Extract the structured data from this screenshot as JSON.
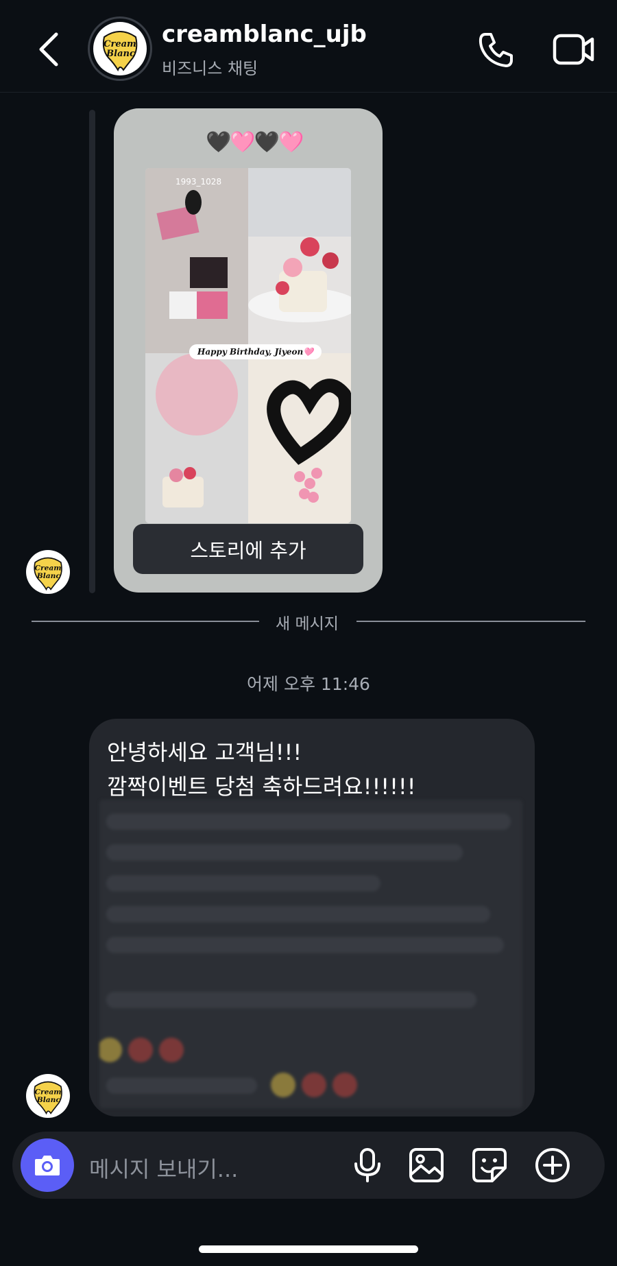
{
  "header": {
    "username": "creamblanc_ujb",
    "subtitle": "비즈니스 채팅",
    "avatar_text": "Cream Blanc"
  },
  "icons": {
    "back": "chevron-left-icon",
    "call": "phone-icon",
    "video": "video-camera-icon",
    "camera": "camera-icon",
    "mic": "microphone-icon",
    "gallery": "image-icon",
    "sticker": "sticker-icon",
    "plus": "plus-circle-icon"
  },
  "story": {
    "hearts": "🖤🩷🖤🩷",
    "story_user": "1993_1028",
    "birthday_text": "Happy Birthday, Jiyeon🩷",
    "add_button": "스토리에 추가"
  },
  "divider": {
    "label": "새 메시지"
  },
  "timestamp": "어제 오후 11:46",
  "message": {
    "line1": "안녕하세요 고객님!!!",
    "line2": "깜짝이벤트 당첨 축하드려요!!!!!!"
  },
  "composer": {
    "placeholder": "메시지 보내기..."
  },
  "colors": {
    "background": "#0b0f14",
    "bubble": "#24272d",
    "story_bg": "#bfc2c0",
    "camera_accent": "#5b5ef6"
  }
}
